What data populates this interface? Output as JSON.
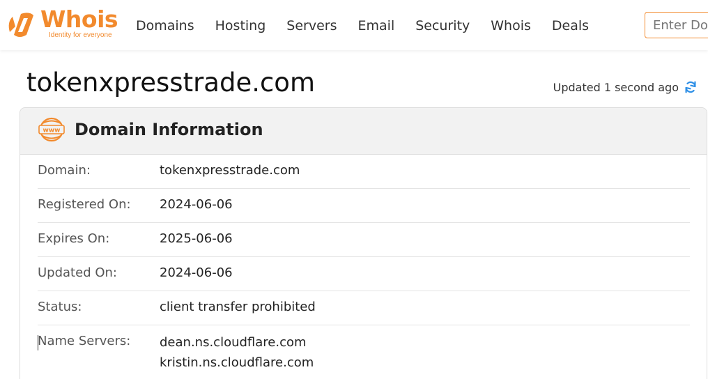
{
  "brand": {
    "name": "Whois",
    "tagline": "Identity for everyone",
    "accent_color": "#f28a2d"
  },
  "nav": {
    "items": [
      "Domains",
      "Hosting",
      "Servers",
      "Email",
      "Security",
      "Whois",
      "Deals"
    ]
  },
  "search": {
    "placeholder": "Enter Domain"
  },
  "page": {
    "title": "tokenxpresstrade.com",
    "updated": "Updated 1 second ago"
  },
  "card": {
    "title": "Domain Information",
    "icon": "www-icon",
    "rows": [
      {
        "label": "Domain:",
        "value": "tokenxpresstrade.com"
      },
      {
        "label": "Registered On:",
        "value": "2024-06-06"
      },
      {
        "label": "Expires On:",
        "value": "2025-06-06"
      },
      {
        "label": "Updated On:",
        "value": "2024-06-06"
      },
      {
        "label": "Status:",
        "value": "client transfer prohibited"
      }
    ],
    "name_servers": {
      "label": "Name Servers:",
      "values": [
        "dean.ns.cloudflare.com",
        "kristin.ns.cloudflare.com"
      ]
    }
  }
}
